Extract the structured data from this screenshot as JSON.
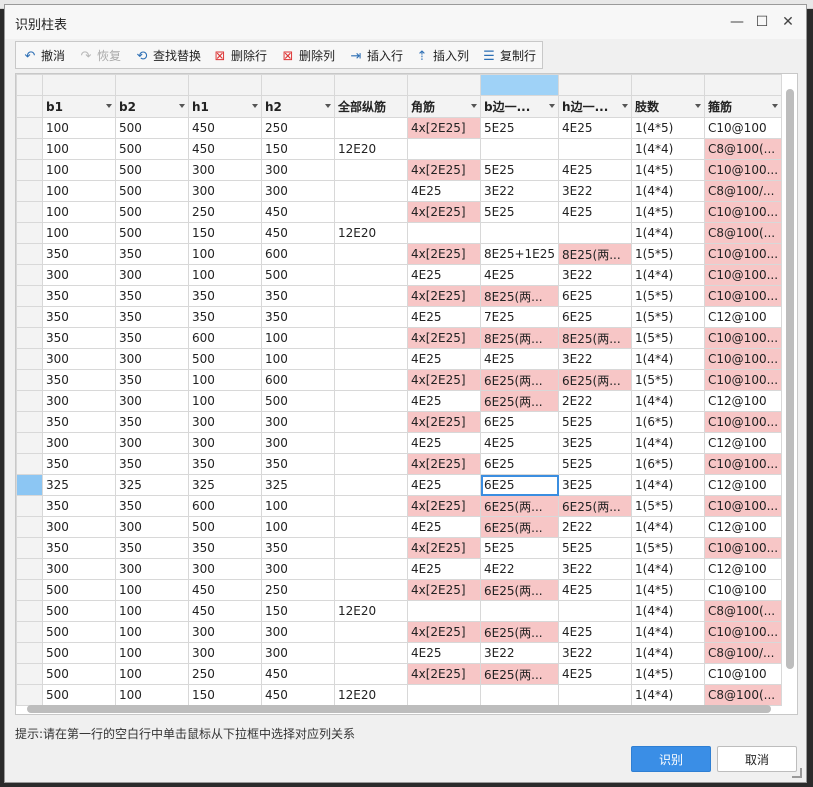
{
  "window": {
    "title": "识别柱表",
    "minimize": "—",
    "maximize": "☐",
    "close": "✕"
  },
  "toolbar": {
    "undo": "撤消",
    "redo": "恢复",
    "find_replace": "查找替换",
    "delete_row": "删除行",
    "delete_col": "删除列",
    "insert_row": "插入行",
    "insert_col": "插入列",
    "copy_row": "复制行"
  },
  "grid": {
    "columns": [
      "b1",
      "b2",
      "h1",
      "h2",
      "全部纵筋",
      "角筋",
      "b边一...",
      "h边一...",
      "肢数",
      "箍筋"
    ],
    "rows": [
      [
        "100",
        "500",
        "450",
        "250",
        "",
        "4x[2E25]",
        "5E25",
        "4E25",
        "1(4*5)",
        "C10@100"
      ],
      [
        "100",
        "500",
        "450",
        "150",
        "12E20",
        "",
        "",
        "",
        "1(4*4)",
        "C8@100(..."
      ],
      [
        "100",
        "500",
        "300",
        "300",
        "",
        "4x[2E25]",
        "5E25",
        "4E25",
        "1(4*5)",
        "C10@100..."
      ],
      [
        "100",
        "500",
        "300",
        "300",
        "",
        "4E25",
        "3E22",
        "3E22",
        "1(4*4)",
        "C8@100/..."
      ],
      [
        "100",
        "500",
        "250",
        "450",
        "",
        "4x[2E25]",
        "5E25",
        "4E25",
        "1(4*5)",
        "C10@100..."
      ],
      [
        "100",
        "500",
        "150",
        "450",
        "12E20",
        "",
        "",
        "",
        "1(4*4)",
        "C8@100(..."
      ],
      [
        "350",
        "350",
        "100",
        "600",
        "",
        "4x[2E25]",
        "8E25+1E25",
        "8E25(两...",
        "1(5*5)",
        "C10@100..."
      ],
      [
        "300",
        "300",
        "100",
        "500",
        "",
        "4E25",
        "4E25",
        "3E22",
        "1(4*4)",
        "C10@100..."
      ],
      [
        "350",
        "350",
        "350",
        "350",
        "",
        "4x[2E25]",
        "8E25(两...",
        "6E25",
        "1(5*5)",
        "C10@100..."
      ],
      [
        "350",
        "350",
        "350",
        "350",
        "",
        "4E25",
        "7E25",
        "6E25",
        "1(5*5)",
        "C12@100"
      ],
      [
        "350",
        "350",
        "600",
        "100",
        "",
        "4x[2E25]",
        "8E25(两...",
        "8E25(两...",
        "1(5*5)",
        "C10@100..."
      ],
      [
        "300",
        "300",
        "500",
        "100",
        "",
        "4E25",
        "4E25",
        "3E22",
        "1(4*4)",
        "C10@100..."
      ],
      [
        "350",
        "350",
        "100",
        "600",
        "",
        "4x[2E25]",
        "6E25(两...",
        "6E25(两...",
        "1(5*5)",
        "C10@100..."
      ],
      [
        "300",
        "300",
        "100",
        "500",
        "",
        "4E25",
        "6E25(两...",
        "2E22",
        "1(4*4)",
        "C12@100"
      ],
      [
        "350",
        "350",
        "300",
        "300",
        "",
        "4x[2E25]",
        "6E25",
        "5E25",
        "1(6*5)",
        "C10@100..."
      ],
      [
        "300",
        "300",
        "300",
        "300",
        "",
        "4E25",
        "4E25",
        "3E25",
        "1(4*4)",
        "C12@100"
      ],
      [
        "350",
        "350",
        "350",
        "350",
        "",
        "4x[2E25]",
        "6E25",
        "5E25",
        "1(6*5)",
        "C10@100..."
      ],
      [
        "325",
        "325",
        "325",
        "325",
        "",
        "4E25",
        "6E25",
        "3E25",
        "1(4*4)",
        "C12@100"
      ],
      [
        "350",
        "350",
        "600",
        "100",
        "",
        "4x[2E25]",
        "6E25(两...",
        "6E25(两...",
        "1(5*5)",
        "C10@100..."
      ],
      [
        "300",
        "300",
        "500",
        "100",
        "",
        "4E25",
        "6E25(两...",
        "2E22",
        "1(4*4)",
        "C12@100"
      ],
      [
        "350",
        "350",
        "350",
        "350",
        "",
        "4x[2E25]",
        "5E25",
        "5E25",
        "1(5*5)",
        "C10@100..."
      ],
      [
        "300",
        "300",
        "300",
        "300",
        "",
        "4E25",
        "4E22",
        "3E22",
        "1(4*4)",
        "C12@100"
      ],
      [
        "500",
        "100",
        "450",
        "250",
        "",
        "4x[2E25]",
        "6E25(两...",
        "4E25",
        "1(4*5)",
        "C10@100"
      ],
      [
        "500",
        "100",
        "450",
        "150",
        "12E20",
        "",
        "",
        "",
        "1(4*4)",
        "C8@100(..."
      ],
      [
        "500",
        "100",
        "300",
        "300",
        "",
        "4x[2E25]",
        "6E25(两...",
        "4E25",
        "1(4*4)",
        "C10@100..."
      ],
      [
        "500",
        "100",
        "300",
        "300",
        "",
        "4E25",
        "3E22",
        "3E22",
        "1(4*4)",
        "C8@100/..."
      ],
      [
        "500",
        "100",
        "250",
        "450",
        "",
        "4x[2E25]",
        "6E25(两...",
        "4E25",
        "1(4*5)",
        "C10@100"
      ],
      [
        "500",
        "100",
        "150",
        "450",
        "12E20",
        "",
        "",
        "",
        "1(4*4)",
        "C8@100(..."
      ]
    ],
    "pink_cells": [
      [
        0,
        5
      ],
      [
        1,
        9
      ],
      [
        2,
        5
      ],
      [
        2,
        9
      ],
      [
        3,
        9
      ],
      [
        4,
        5
      ],
      [
        4,
        9
      ],
      [
        5,
        9
      ],
      [
        6,
        5
      ],
      [
        6,
        7
      ],
      [
        6,
        9
      ],
      [
        7,
        9
      ],
      [
        8,
        5
      ],
      [
        8,
        6
      ],
      [
        8,
        9
      ],
      [
        10,
        5
      ],
      [
        10,
        6
      ],
      [
        10,
        7
      ],
      [
        10,
        9
      ],
      [
        11,
        9
      ],
      [
        12,
        5
      ],
      [
        12,
        6
      ],
      [
        12,
        7
      ],
      [
        12,
        9
      ],
      [
        13,
        6
      ],
      [
        14,
        5
      ],
      [
        14,
        9
      ],
      [
        16,
        5
      ],
      [
        16,
        9
      ],
      [
        18,
        5
      ],
      [
        18,
        6
      ],
      [
        18,
        7
      ],
      [
        18,
        9
      ],
      [
        19,
        6
      ],
      [
        20,
        5
      ],
      [
        20,
        9
      ],
      [
        22,
        5
      ],
      [
        22,
        6
      ],
      [
        23,
        9
      ],
      [
        24,
        5
      ],
      [
        24,
        6
      ],
      [
        24,
        9
      ],
      [
        25,
        9
      ],
      [
        26,
        5
      ],
      [
        26,
        6
      ],
      [
        27,
        9
      ]
    ],
    "current_row": 17,
    "active_col": 6,
    "selected_top_col": 6
  },
  "hint": "提示:请在第一行的空白行中单击鼠标从下拉框中选择对应列关系",
  "buttons": {
    "ok": "识别",
    "cancel": "取消"
  }
}
